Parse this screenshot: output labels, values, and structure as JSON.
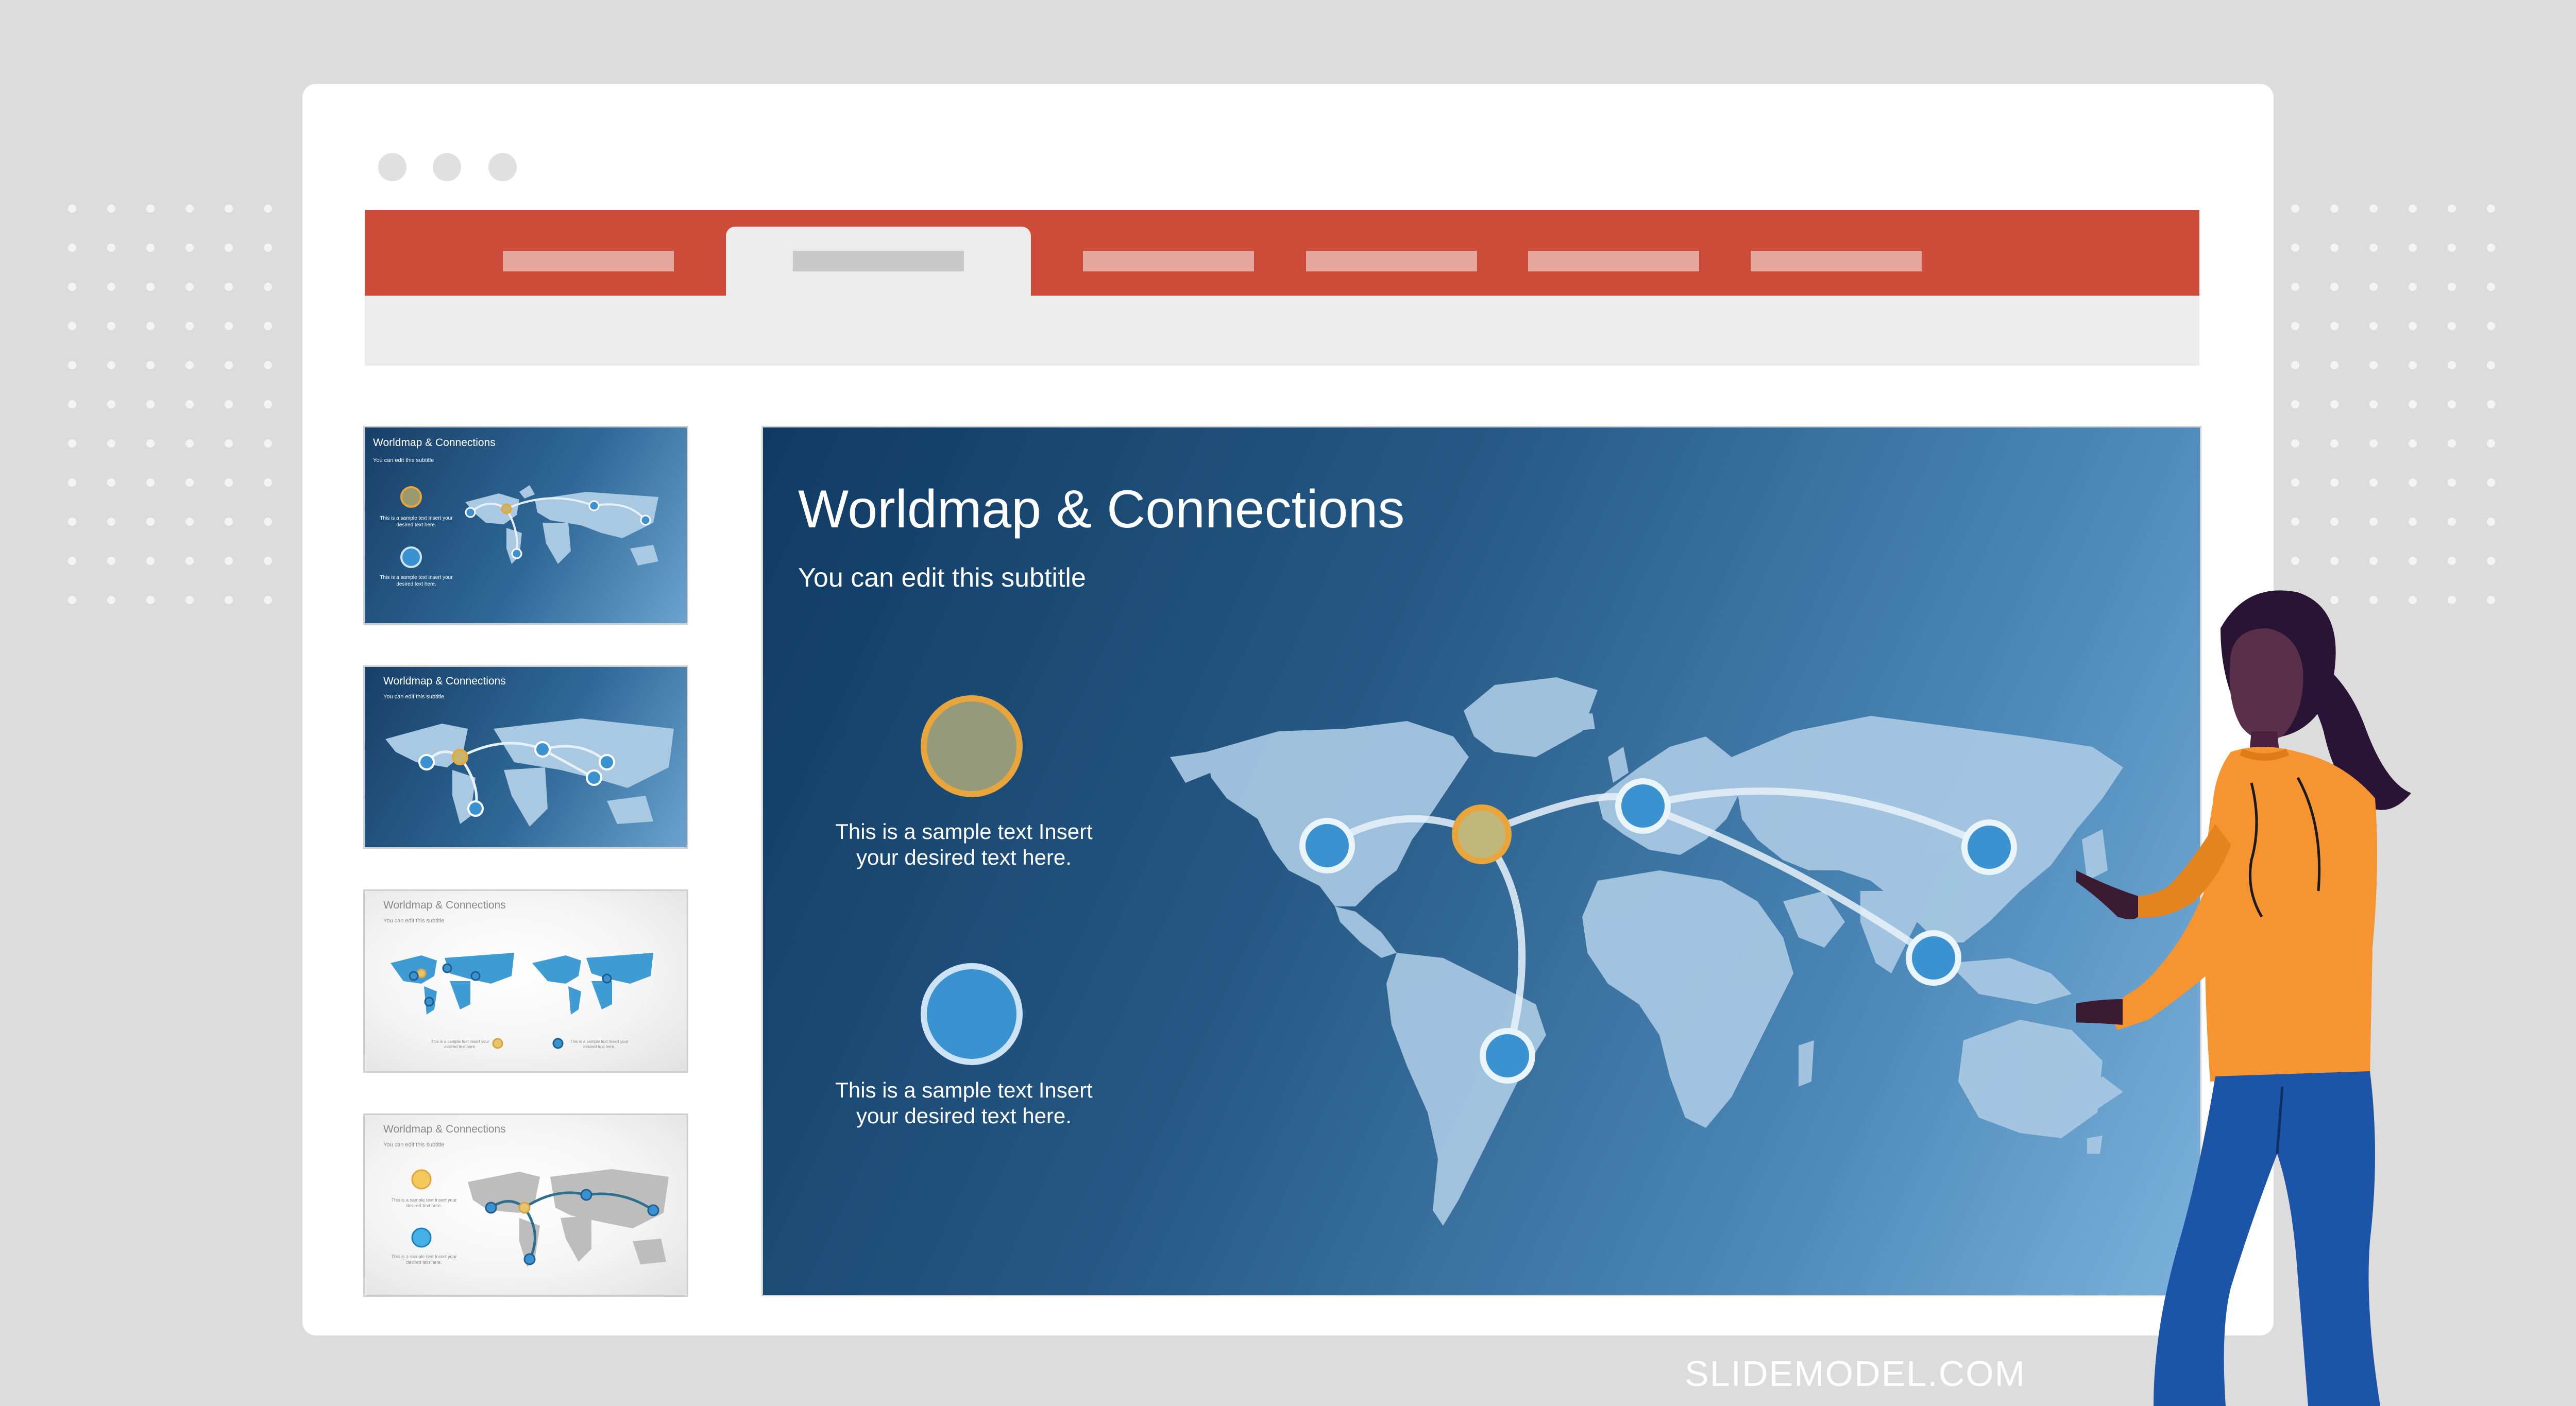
{
  "slide": {
    "title": "Worldmap & Connections",
    "subtitle": "You can edit this subtitle",
    "text_1": "This is a sample text Insert your desired text here.",
    "text_2": "This is a sample text Insert your desired text here."
  },
  "thumbnails": [
    {
      "title": "Worldmap & Connections",
      "subtitle": "You can edit this subtitle",
      "text_1": "This is a sample text Insert your desired text here.",
      "text_2": "This is a sample text Insert your desired text here."
    },
    {
      "title": "Worldmap & Connections",
      "subtitle": "You can edit this subtitle"
    },
    {
      "title": "Worldmap & Connections",
      "subtitle": "You can edit this subtitle",
      "text_1": "This is a sample text Insert your desired text here.",
      "text_2": "This is a sample text Insert your desired text here."
    },
    {
      "title": "Worldmap & Connections",
      "subtitle": "You can edit this subtitle",
      "text_1": "This is a sample text Insert your desired text here.",
      "text_2": "This is a sample text Insert your desired text here."
    }
  ],
  "footer": {
    "brand": "SLIDEMODEL.COM"
  },
  "colors": {
    "ribbon": "#cd4b39",
    "accent_gold": "#e8a53c",
    "accent_blue": "#3a93d0",
    "slide_bg_dark": "#0f3a63",
    "slide_bg_light": "#7cb2db",
    "background": "#dcdcdc"
  },
  "icons": [
    "window-control-icon",
    "world-map-icon",
    "connection-node-icon",
    "presenter-illustration"
  ]
}
